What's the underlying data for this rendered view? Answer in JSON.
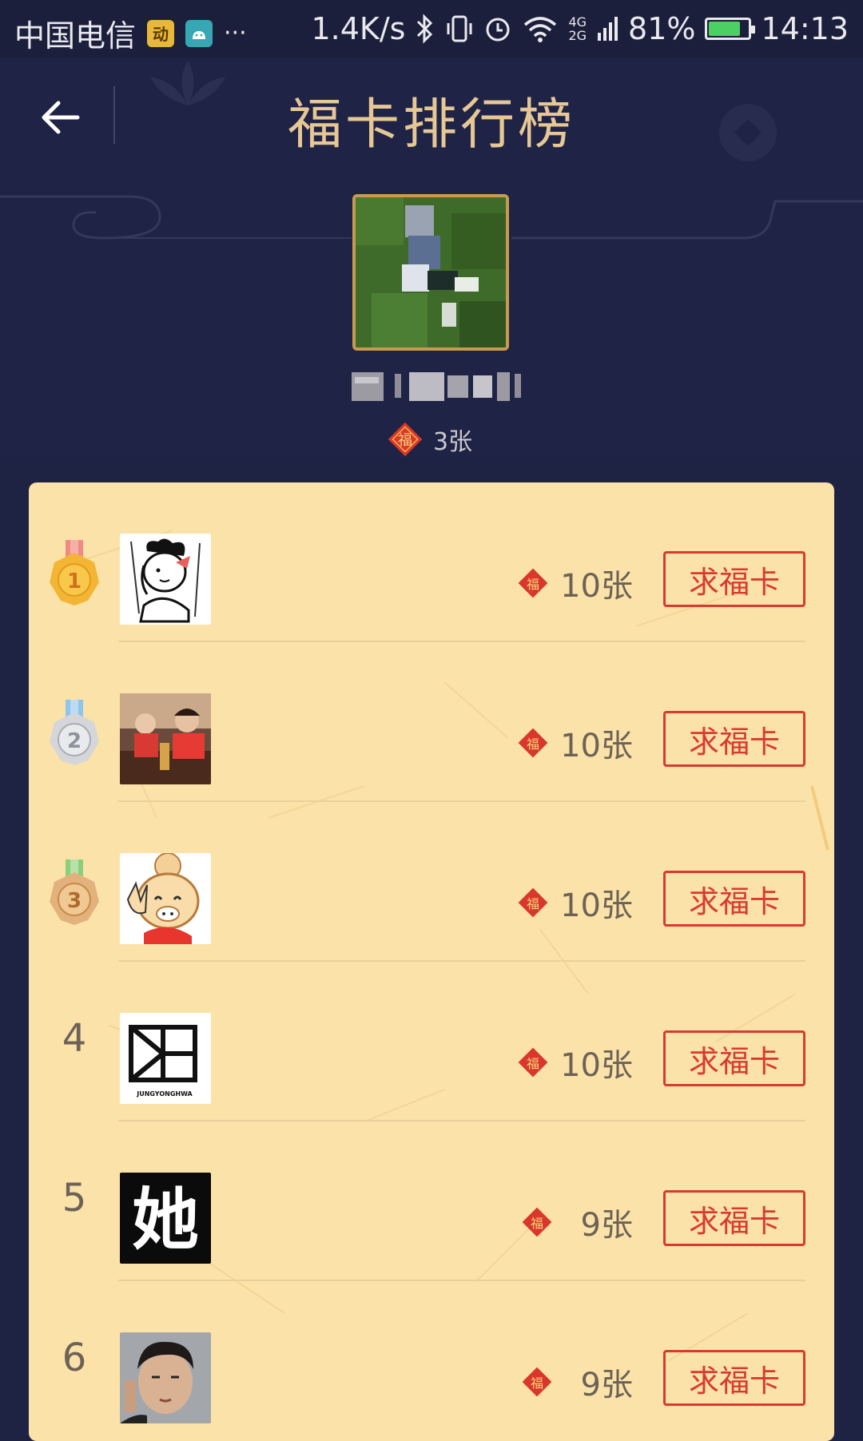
{
  "status_bar": {
    "carrier": "中国电信",
    "app_badge_1": "动",
    "more": "···",
    "speed": "1.4K/s",
    "network_top": "4G",
    "network_bottom": "2G",
    "battery": "81%",
    "battery_level": 0.81,
    "time": "14:13"
  },
  "header": {
    "title": "福卡排行榜"
  },
  "profile": {
    "card_count": "3张",
    "fu_char": "福"
  },
  "ranking": {
    "rows": [
      {
        "rank": "1",
        "count": "10张",
        "button": "求福卡"
      },
      {
        "rank": "2",
        "count": "10张",
        "button": "求福卡"
      },
      {
        "rank": "3",
        "count": "10张",
        "button": "求福卡"
      },
      {
        "rank": "4",
        "count": "10张",
        "button": "求福卡"
      },
      {
        "rank": "5",
        "count": "9张",
        "button": "求福卡"
      },
      {
        "rank": "6",
        "count": "9张",
        "button": "求福卡"
      }
    ],
    "avatar4_text": "JUNGYONGHWA",
    "avatar5_text": "她"
  },
  "colors": {
    "background": "#1f2446",
    "title_gold": "#e6c795",
    "panel": "#fbe2a8",
    "button_red": "#d93a30",
    "gold_medal": "#f2b634",
    "silver_medal": "#d4d6da",
    "bronze_medal": "#e3b27c"
  }
}
